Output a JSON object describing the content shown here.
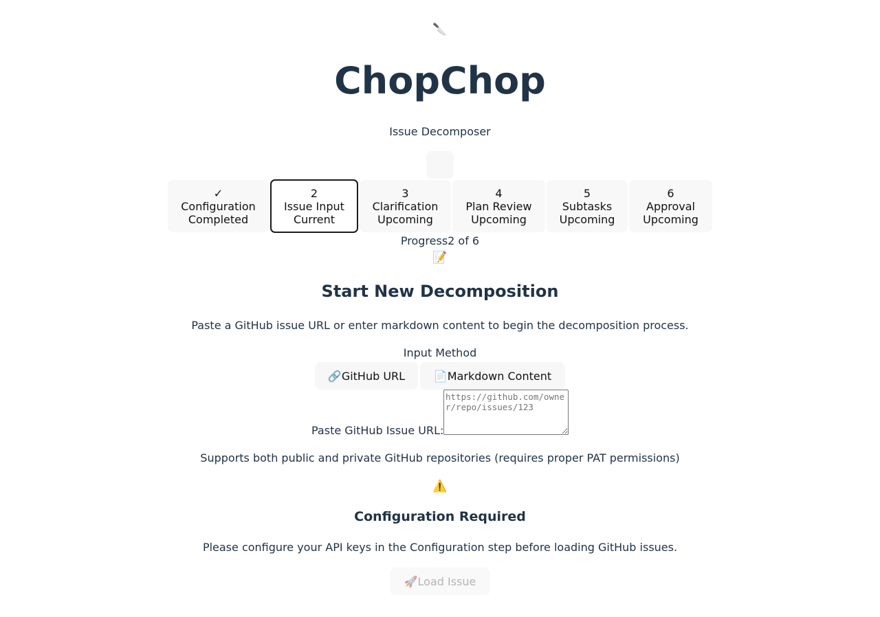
{
  "header": {
    "logo_icon": "knife-icon",
    "logo_glyph": "🔪",
    "title": "ChopChop",
    "subtitle": "Issue Decomposer"
  },
  "stepper": {
    "steps": [
      {
        "number": "✓",
        "name": "Configuration",
        "status": "Completed"
      },
      {
        "number": "2",
        "name": "Issue Input",
        "status": "Current"
      },
      {
        "number": "3",
        "name": "Clarification",
        "status": "Upcoming"
      },
      {
        "number": "4",
        "name": "Plan Review",
        "status": "Upcoming"
      },
      {
        "number": "5",
        "name": "Subtasks",
        "status": "Upcoming"
      },
      {
        "number": "6",
        "name": "Approval",
        "status": "Upcoming"
      }
    ],
    "progress_text": "Progress2 of 6",
    "current_step": 2,
    "total_steps": 6
  },
  "main": {
    "section_icon": "memo-icon",
    "section_glyph": "📝",
    "title": "Start New Decomposition",
    "description": "Paste a GitHub issue URL or enter markdown content to begin the decomposition process.",
    "input_method_label": "Input Method",
    "tabs": [
      {
        "icon": "link-icon",
        "glyph": "🔗",
        "label": "GitHub URL"
      },
      {
        "icon": "document-icon",
        "glyph": "📄",
        "label": "Markdown Content"
      }
    ],
    "url_label": "Paste GitHub Issue URL:",
    "url_value": "",
    "url_placeholder": "https://github.com/owner/repo/issues/123",
    "help_text": "Supports both public and private GitHub repositories (requires proper PAT permissions)"
  },
  "warning": {
    "icon": "warning-icon",
    "glyph": "⚠️",
    "title": "Configuration Required",
    "message": "Please configure your API keys in the Configuration step before loading GitHub issues."
  },
  "actions": {
    "load_icon": "rocket-icon",
    "load_glyph": "🚀",
    "load_label": "Load Issue"
  },
  "colors": {
    "heading": "#213347",
    "step_bg": "#f8f8f8",
    "current_border": "#1a1a1a",
    "disabled_text": "#b4b4b4"
  }
}
